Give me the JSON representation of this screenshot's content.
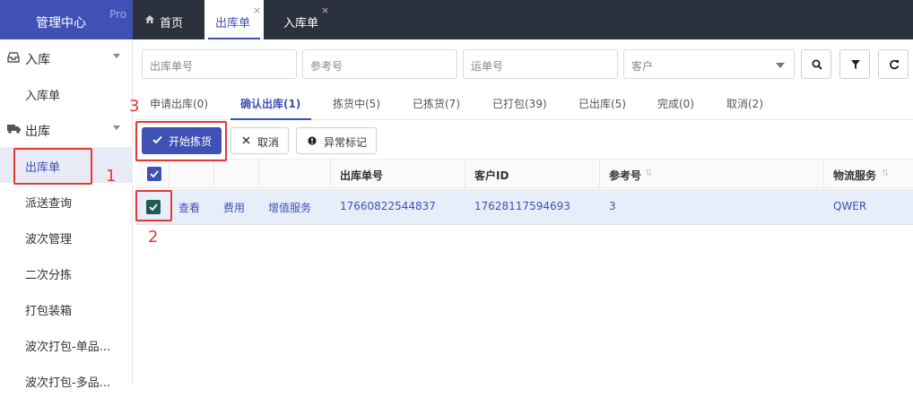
{
  "brand": {
    "title": "管理中心",
    "badge": "Pro"
  },
  "tabs": [
    {
      "label": "首页",
      "icon": "home-icon"
    },
    {
      "label": "出库单",
      "close": "×"
    },
    {
      "label": "入库单",
      "close": "×"
    }
  ],
  "sidebar": {
    "groups": [
      {
        "label": "入库",
        "icon": "inbox-icon",
        "items": [
          "入库单"
        ]
      },
      {
        "label": "出库",
        "icon": "truck-icon",
        "items": [
          "出库单",
          "派送查询",
          "波次管理",
          "二次分拣",
          "打包装箱",
          "波次打包-单品...",
          "波次打包-多品..."
        ]
      }
    ]
  },
  "filters": {
    "order_no": "出库单号",
    "ref_no": "参考号",
    "tracking_no": "运单号",
    "customer": "客户"
  },
  "status_tabs": [
    {
      "label": "申请出库(0)"
    },
    {
      "label": "确认出库(1)"
    },
    {
      "label": "拣货中(5)"
    },
    {
      "label": "已拣货(7)"
    },
    {
      "label": "已打包(39)"
    },
    {
      "label": "已出库(5)"
    },
    {
      "label": "完成(0)"
    },
    {
      "label": "取消(2)"
    }
  ],
  "actions": {
    "start_picking": "开始拣货",
    "cancel": "取消",
    "exception": "异常标记"
  },
  "table": {
    "columns": [
      "出库单号",
      "客户ID",
      "参考号",
      "物流服务"
    ],
    "rows": [
      {
        "view": "查看",
        "fee": "费用",
        "value_added": "增值服务",
        "order_no": "17660822544837",
        "customer_id": "17628117594693",
        "ref_no": "3",
        "logistics": "QWER"
      }
    ]
  },
  "annotations": [
    "1",
    "2",
    "3"
  ],
  "colors": {
    "primary": "#3f51b5",
    "topbar": "#2b313d",
    "annotation": "#e53935"
  }
}
